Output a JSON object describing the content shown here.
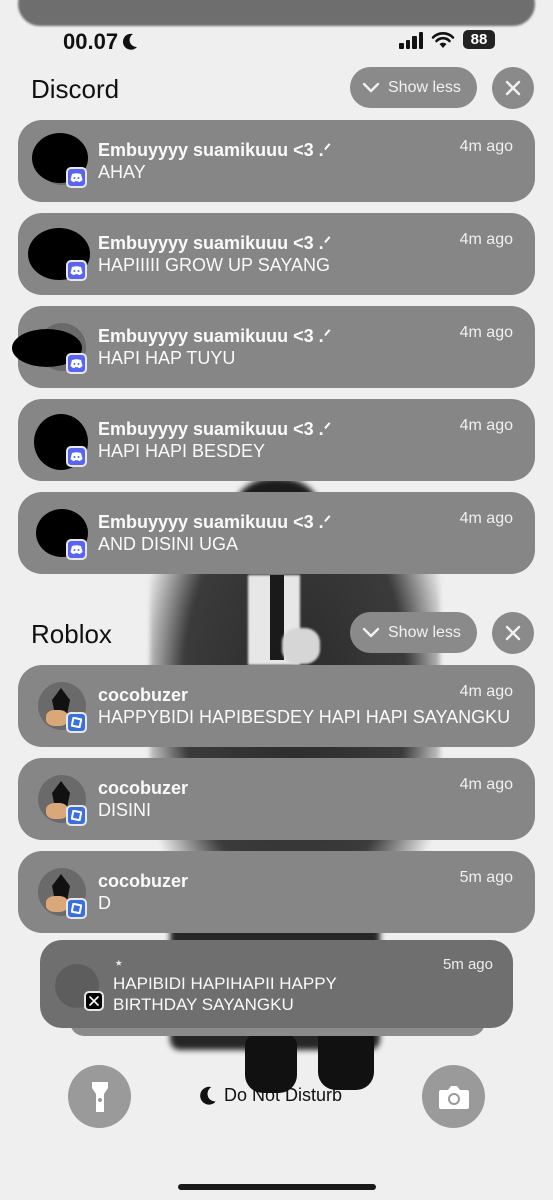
{
  "status_bar": {
    "time": "00.07",
    "battery": "88",
    "focus_icon": "moon-icon"
  },
  "discord": {
    "title": "Discord",
    "show_less": "Show less",
    "notifications": [
      {
        "title": "Embuyyyy suamikuuu <3 .ᐟ",
        "body": "AHAY",
        "time": "4m ago"
      },
      {
        "title": "Embuyyyy suamikuuu <3 .ᐟ",
        "body": "HAPIIIII GROW UP SAYANG",
        "time": "4m ago"
      },
      {
        "title": "Embuyyyy suamikuuu <3 .ᐟ",
        "body": "HAPI HAP TUYU",
        "time": "4m ago"
      },
      {
        "title": "Embuyyyy suamikuuu <3 .ᐟ",
        "body": "HAPI HAPI BESDEY",
        "time": "4m ago"
      },
      {
        "title": "Embuyyyy suamikuuu <3 .ᐟ",
        "body": "AND DISINI UGA",
        "time": "4m ago"
      }
    ]
  },
  "roblox": {
    "title": "Roblox",
    "show_less": "Show less",
    "notifications": [
      {
        "title": "cocobuzer",
        "body": "HAPPYBIDI HAPIBESDEY HAPI HAPI SAYANGKU",
        "time": "4m ago"
      },
      {
        "title": "cocobuzer",
        "body": "DISINI",
        "time": "4m ago"
      },
      {
        "title": "cocobuzer",
        "body": "D",
        "time": "5m ago"
      }
    ]
  },
  "x_notification": {
    "title": "⭑",
    "body": "HAPIBIDI HAPIHAPII HAPPY BIRTHDAY SAYANGKU",
    "time": "5m ago"
  },
  "bottom": {
    "do_not_disturb": "Do Not Disturb"
  },
  "colors": {
    "discord": "#5865f2",
    "roblox": "#3a6fe0"
  }
}
